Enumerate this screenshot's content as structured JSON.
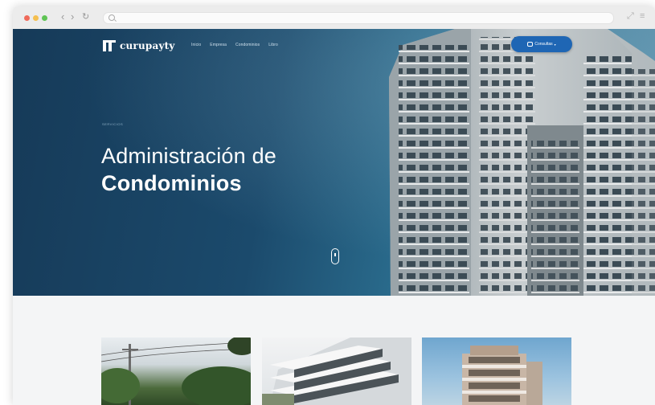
{
  "browser": {
    "nav_back": "‹",
    "nav_forward": "›",
    "nav_reload": "↻",
    "expand_glyph": "⤢",
    "menu_glyph": "≡"
  },
  "site": {
    "brand": "curupayty",
    "nav": [
      {
        "label": "Inicio"
      },
      {
        "label": "Empresa"
      },
      {
        "label": "Condominios"
      },
      {
        "label": "Libro"
      }
    ],
    "cta_label": "Consultas"
  },
  "hero": {
    "eyebrow": "SERVICIOS",
    "title_line1": "Administración de",
    "title_line2": "Condominios"
  },
  "colors": {
    "hero_dark": "#163a58",
    "cta_blue": "#1f66b4",
    "page_bg": "#f4f5f6"
  }
}
